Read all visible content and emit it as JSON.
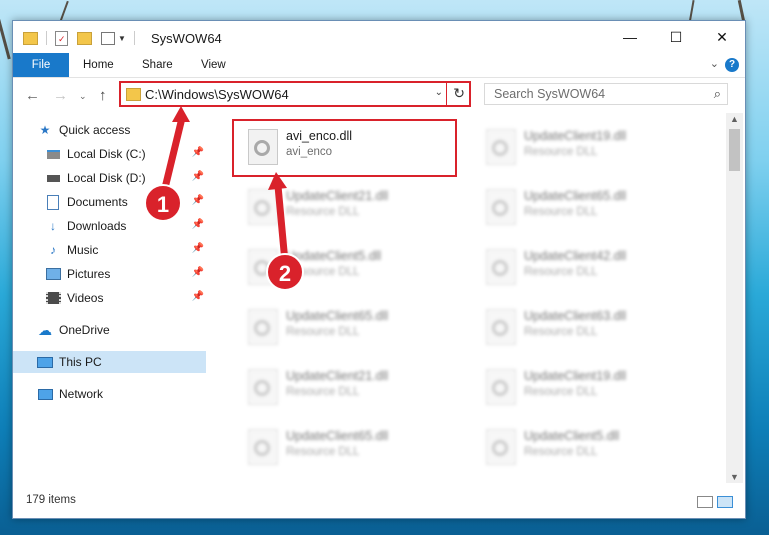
{
  "window": {
    "title": "SysWOW64",
    "controls": {
      "minimize": "—",
      "maximize": "☐",
      "close": "✕"
    }
  },
  "ribbon": {
    "tabs": [
      "File",
      "Home",
      "Share",
      "View"
    ],
    "help": "?"
  },
  "navigation": {
    "address": "C:\\Windows\\SysWOW64",
    "search_placeholder": "Search SysWOW64"
  },
  "sidebar": {
    "items": [
      {
        "label": "Quick access",
        "icon": "star-icon",
        "pinned": false
      },
      {
        "label": "Local Disk (C:)",
        "icon": "drive-icon",
        "pinned": true
      },
      {
        "label": "Local Disk (D:)",
        "icon": "drive-icon",
        "pinned": true
      },
      {
        "label": "Documents",
        "icon": "documents-icon",
        "pinned": true
      },
      {
        "label": "Downloads",
        "icon": "downloads-icon",
        "pinned": true
      },
      {
        "label": "Music",
        "icon": "music-icon",
        "pinned": true
      },
      {
        "label": "Pictures",
        "icon": "pictures-icon",
        "pinned": true
      },
      {
        "label": "Videos",
        "icon": "videos-icon",
        "pinned": true
      },
      {
        "label": "OneDrive",
        "icon": "cloud-icon",
        "pinned": false
      },
      {
        "label": "This PC",
        "icon": "computer-icon",
        "pinned": false,
        "selected": true
      },
      {
        "label": "Network",
        "icon": "network-icon",
        "pinned": false
      }
    ]
  },
  "files": {
    "highlighted": {
      "name": "avi_enco.dll",
      "type": "avi_enco"
    },
    "blurred": [
      {
        "name": "UpdateClient19.dll",
        "type": "Resource DLL"
      },
      {
        "name": "UpdateClient21.dll",
        "type": "Resource DLL"
      },
      {
        "name": "UpdateClient65.dll",
        "type": "Resource DLL"
      },
      {
        "name": "UpdateClient5.dll",
        "type": "Resource DLL"
      },
      {
        "name": "UpdateClient42.dll",
        "type": "Resource DLL"
      },
      {
        "name": "UpdateClient65.dll",
        "type": "Resource DLL"
      },
      {
        "name": "UpdateClient63.dll",
        "type": "Resource DLL"
      },
      {
        "name": "UpdateClient21.dll",
        "type": "Resource DLL"
      },
      {
        "name": "UpdateClient19.dll",
        "type": "Resource DLL"
      },
      {
        "name": "UpdateClient65.dll",
        "type": "Resource DLL"
      },
      {
        "name": "UpdateClient5.dll",
        "type": "Resource DLL"
      }
    ]
  },
  "status": {
    "item_count": "179 items"
  },
  "annotations": {
    "step1": "1",
    "step2": "2",
    "color": "#d9222b"
  }
}
